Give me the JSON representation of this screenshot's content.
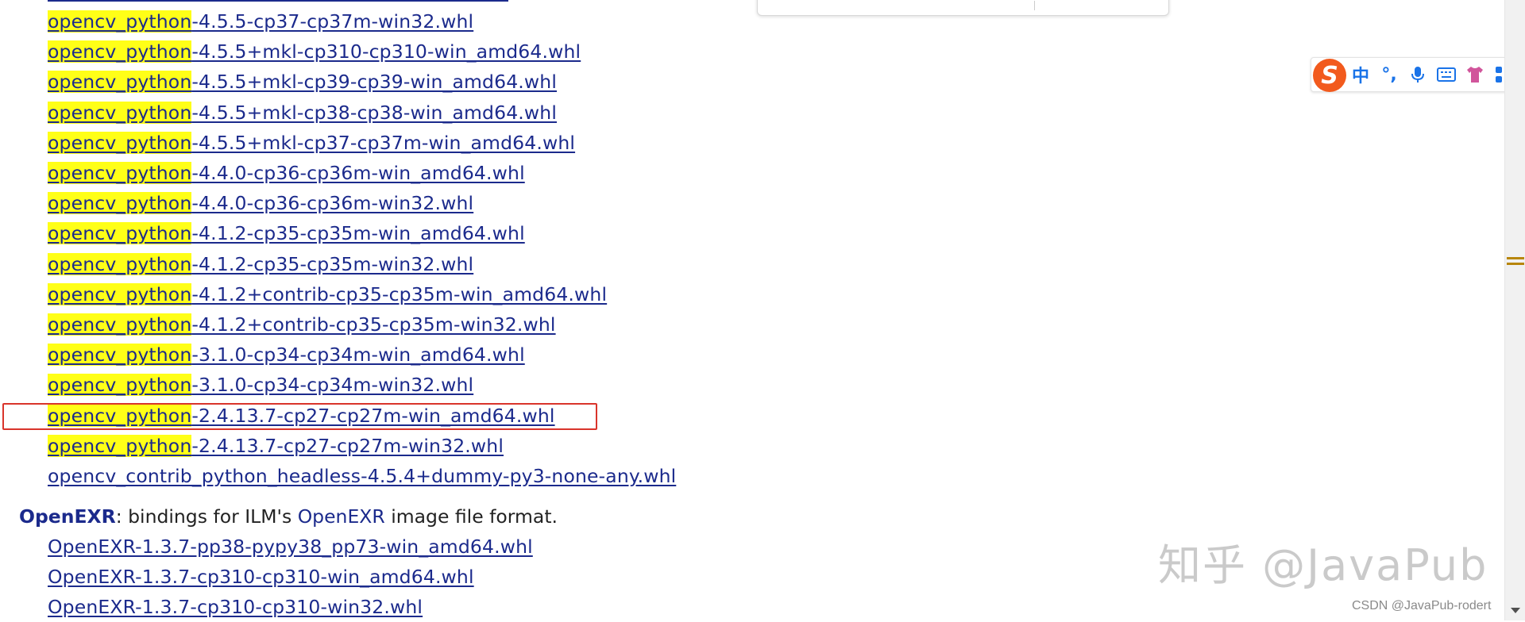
{
  "links": [
    {
      "prefix": "opencv_python",
      "suffix": "-4.5.5-cp37-cp37m-win32.whl"
    },
    {
      "prefix": "opencv_python",
      "suffix": "-4.5.5+mkl-cp310-cp310-win_amd64.whl"
    },
    {
      "prefix": "opencv_python",
      "suffix": "-4.5.5+mkl-cp39-cp39-win_amd64.whl"
    },
    {
      "prefix": "opencv_python",
      "suffix": "-4.5.5+mkl-cp38-cp38-win_amd64.whl"
    },
    {
      "prefix": "opencv_python",
      "suffix": "-4.5.5+mkl-cp37-cp37m-win_amd64.whl"
    },
    {
      "prefix": "opencv_python",
      "suffix": "-4.4.0-cp36-cp36m-win_amd64.whl"
    },
    {
      "prefix": "opencv_python",
      "suffix": "-4.4.0-cp36-cp36m-win32.whl"
    },
    {
      "prefix": "opencv_python",
      "suffix": "-4.1.2-cp35-cp35m-win_amd64.whl"
    },
    {
      "prefix": "opencv_python",
      "suffix": "-4.1.2-cp35-cp35m-win32.whl"
    },
    {
      "prefix": "opencv_python",
      "suffix": "-4.1.2+contrib-cp35-cp35m-win_amd64.whl"
    },
    {
      "prefix": "opencv_python",
      "suffix": "-4.1.2+contrib-cp35-cp35m-win32.whl"
    },
    {
      "prefix": "opencv_python",
      "suffix": "-3.1.0-cp34-cp34m-win_amd64.whl"
    },
    {
      "prefix": "opencv_python",
      "suffix": "-3.1.0-cp34-cp34m-win32.whl"
    },
    {
      "prefix": "opencv_python",
      "suffix": "-2.4.13.7-cp27-cp27m-win_amd64.whl"
    },
    {
      "prefix": "opencv_python",
      "suffix": "-2.4.13.7-cp27-cp27m-win32.whl"
    },
    {
      "prefix": "",
      "suffix": "opencv_contrib_python_headless-4.5.4+dummy-py3-none-any.whl"
    }
  ],
  "openexr": {
    "name": "OpenEXR",
    "desc_a": ": bindings for ILM's ",
    "desc_link": "OpenEXR",
    "desc_b": " image file format.",
    "files": [
      "OpenEXR-1.3.7-pp38-pypy38_pp73-win_amd64.whl",
      "OpenEXR-1.3.7-cp310-cp310-win_amd64.whl",
      "OpenEXR-1.3.7-cp310-cp310-win32.whl"
    ]
  },
  "ime_toolbar": {
    "logo": "S",
    "items": [
      "中",
      "°,",
      "mic-icon",
      "keyboard-icon",
      "shirt-icon",
      "apps-icon"
    ],
    "items_text": [
      "中",
      "°,"
    ]
  },
  "watermark": "知乎 @JavaPub",
  "credit": "CSDN @JavaPub-rodert",
  "colors": {
    "link": "#1b2a8c",
    "highlight": "#ffff17",
    "box": "#d9342b",
    "ime": "#f25a1d"
  }
}
